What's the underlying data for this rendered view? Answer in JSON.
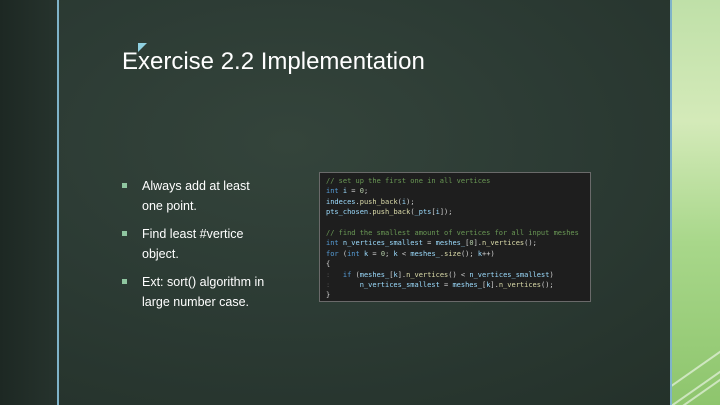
{
  "slide": {
    "title": "Exercise 2.2 Implementation",
    "bullets": [
      "Always add at least one point.",
      "Find least #vertice object.",
      "Ext: sort() algorithm in large number case."
    ],
    "code_lines": [
      [
        {
          "t": "// set up the first one in all vertices",
          "c": "comment"
        }
      ],
      [
        {
          "t": "int",
          "c": "kw"
        },
        {
          "t": " ",
          "c": "plain"
        },
        {
          "t": "i",
          "c": "var"
        },
        {
          "t": " = ",
          "c": "plain"
        },
        {
          "t": "0",
          "c": "num"
        },
        {
          "t": ";",
          "c": "plain"
        }
      ],
      [
        {
          "t": "indeces",
          "c": "var"
        },
        {
          "t": ".",
          "c": "plain"
        },
        {
          "t": "push_back",
          "c": "fn"
        },
        {
          "t": "(",
          "c": "plain"
        },
        {
          "t": "i",
          "c": "var"
        },
        {
          "t": ");",
          "c": "plain"
        }
      ],
      [
        {
          "t": "pts_chosen",
          "c": "var"
        },
        {
          "t": ".",
          "c": "plain"
        },
        {
          "t": "push_back",
          "c": "fn"
        },
        {
          "t": "(",
          "c": "plain"
        },
        {
          "t": "_pts",
          "c": "var"
        },
        {
          "t": "[",
          "c": "plain"
        },
        {
          "t": "i",
          "c": "var"
        },
        {
          "t": "]);",
          "c": "plain"
        }
      ],
      [
        {
          "t": "",
          "c": "plain"
        }
      ],
      [
        {
          "t": "// find the smallest amount of vertices for all input meshes",
          "c": "comment"
        }
      ],
      [
        {
          "t": "int",
          "c": "kw"
        },
        {
          "t": " ",
          "c": "plain"
        },
        {
          "t": "n_vertices_smallest",
          "c": "var"
        },
        {
          "t": " = ",
          "c": "plain"
        },
        {
          "t": "meshes_",
          "c": "var"
        },
        {
          "t": "[",
          "c": "plain"
        },
        {
          "t": "0",
          "c": "num"
        },
        {
          "t": "].",
          "c": "plain"
        },
        {
          "t": "n_vertices",
          "c": "fn"
        },
        {
          "t": "();",
          "c": "plain"
        }
      ],
      [
        {
          "t": "for",
          "c": "kw"
        },
        {
          "t": " (",
          "c": "plain"
        },
        {
          "t": "int",
          "c": "kw"
        },
        {
          "t": " ",
          "c": "plain"
        },
        {
          "t": "k",
          "c": "var"
        },
        {
          "t": " = ",
          "c": "plain"
        },
        {
          "t": "0",
          "c": "num"
        },
        {
          "t": "; ",
          "c": "plain"
        },
        {
          "t": "k",
          "c": "var"
        },
        {
          "t": " < ",
          "c": "plain"
        },
        {
          "t": "meshes_",
          "c": "var"
        },
        {
          "t": ".",
          "c": "plain"
        },
        {
          "t": "size",
          "c": "fn"
        },
        {
          "t": "(); ",
          "c": "plain"
        },
        {
          "t": "k",
          "c": "var"
        },
        {
          "t": "++)",
          "c": "plain"
        }
      ],
      [
        {
          "t": "{",
          "c": "plain"
        }
      ],
      [
        {
          "t": ":   ",
          "c": "guide"
        },
        {
          "t": "if",
          "c": "kw"
        },
        {
          "t": " (",
          "c": "plain"
        },
        {
          "t": "meshes_",
          "c": "var"
        },
        {
          "t": "[",
          "c": "plain"
        },
        {
          "t": "k",
          "c": "var"
        },
        {
          "t": "].",
          "c": "plain"
        },
        {
          "t": "n_vertices",
          "c": "fn"
        },
        {
          "t": "() < ",
          "c": "plain"
        },
        {
          "t": "n_vertices_smallest",
          "c": "var"
        },
        {
          "t": ")",
          "c": "plain"
        }
      ],
      [
        {
          "t": ":       ",
          "c": "guide"
        },
        {
          "t": "n_vertices_smallest",
          "c": "var"
        },
        {
          "t": " = ",
          "c": "plain"
        },
        {
          "t": "meshes_",
          "c": "var"
        },
        {
          "t": "[",
          "c": "plain"
        },
        {
          "t": "k",
          "c": "var"
        },
        {
          "t": "].",
          "c": "plain"
        },
        {
          "t": "n_vertices",
          "c": "fn"
        },
        {
          "t": "();",
          "c": "plain"
        }
      ],
      [
        {
          "t": "}",
          "c": "plain"
        }
      ]
    ]
  },
  "colors": {
    "background": "#2c3a33",
    "accent_rule": "#7fb3c9",
    "right_band": "#a8d78a",
    "bullet_marker": "#8fc6a0",
    "code_background": "#1e1e1e"
  }
}
